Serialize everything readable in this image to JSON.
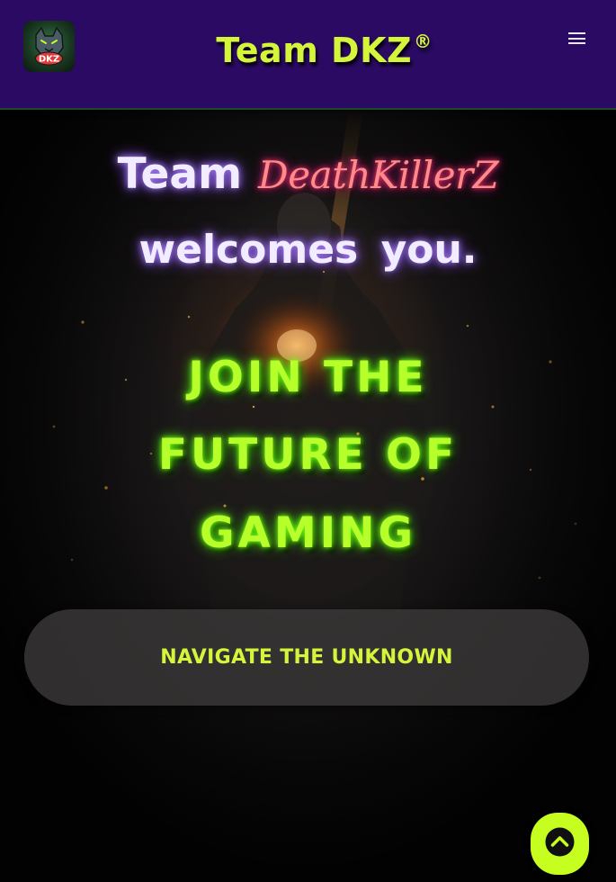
{
  "header": {
    "brand_name": "Team DKZ",
    "registered_mark": "®",
    "logo": {
      "icon": "wolf-mascot-logo",
      "text": "DKZ"
    },
    "menu_icon": "hamburger-menu-icon"
  },
  "hero": {
    "welcome_team": "Team",
    "welcome_name": "DeathKillerZ",
    "welcome_suffix": "welcomes you.",
    "headline_lines": [
      "JOIN THE",
      "FUTURE OF",
      "GAMING"
    ],
    "cta_label": "NAVIGATE THE UNKNOWN"
  },
  "scroll_top": {
    "icon": "chevron-up-icon"
  },
  "colors": {
    "header_bg": "#2a0a63",
    "accent_green": "#d4f53a",
    "neon_green": "#b6ff2a",
    "neon_purple": "#8a4dff",
    "neon_pink": "#ff3b6b",
    "button_bg": "#3a3838",
    "scroll_button_bg": "#c6ff1f"
  }
}
